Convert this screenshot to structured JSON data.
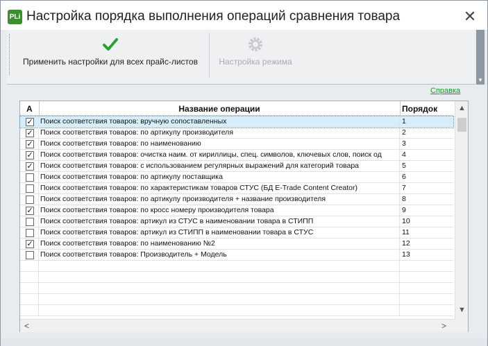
{
  "window": {
    "logo_text": "PLi",
    "title": "Настройка порядка выполнения операций сравнения товара",
    "close_glyph": "✕"
  },
  "toolbar": {
    "apply_label": "Применить настройки для всех прайс-листов",
    "apply_icon": "checkmark-icon",
    "mode_label": "Настройка режима",
    "mode_icon": "gear-icon",
    "mode_enabled": false
  },
  "help_link": "Справка",
  "grid": {
    "headers": {
      "active": "А",
      "name": "Название операции",
      "order": "Порядок"
    },
    "rows": [
      {
        "checked": true,
        "name": "Поиск соответствия товаров: вручную сопоставленных",
        "order": "1",
        "selected": true
      },
      {
        "checked": true,
        "name": "Поиск соответствия товаров: по артикулу производителя",
        "order": "2"
      },
      {
        "checked": true,
        "name": "Поиск соответствия товаров: по наименованию",
        "order": "3"
      },
      {
        "checked": true,
        "name": "Поиск соответствия товаров: очистка наим. от кириллицы, спец. символов, ключевых слов, поиск од",
        "order": "4"
      },
      {
        "checked": true,
        "name": "Поиск соответствия товаров: с использованием регулярных выражений для категорий товара",
        "order": "5"
      },
      {
        "checked": false,
        "name": "Поиск соответствия товаров: по артикулу поставщика",
        "order": "6"
      },
      {
        "checked": false,
        "name": "Поиск соответствия товаров: по характеристикам товаров СТУС (БД E-Trade Content Creator)",
        "order": "7"
      },
      {
        "checked": false,
        "name": "Поиск соответствия товаров: по артикулу производителя + название производителя",
        "order": "8"
      },
      {
        "checked": true,
        "name": "Поиск соответствия товаров: по кросс номеру производителя товара",
        "order": "9"
      },
      {
        "checked": false,
        "name": "Поиск соответствия товаров: артикул из СТУС в наименовании товара в СТИПП",
        "order": "10"
      },
      {
        "checked": false,
        "name": "Поиск соответствия товаров: артикул из СТИПП в наименовании товара в СТУС",
        "order": "11"
      },
      {
        "checked": true,
        "name": "Поиск соответствия товаров: по наименованию №2",
        "order": "12"
      },
      {
        "checked": false,
        "name": "Поиск соответствия товаров: Производитель + Модель",
        "order": "13"
      },
      {
        "checked": false,
        "name": "",
        "order": ""
      },
      {
        "checked": false,
        "name": "",
        "order": ""
      },
      {
        "checked": false,
        "name": "",
        "order": ""
      },
      {
        "checked": false,
        "name": "",
        "order": ""
      },
      {
        "checked": false,
        "name": "",
        "order": ""
      }
    ]
  },
  "colors": {
    "selected_row": "#d6eef9",
    "check_green": "#2e9e2e",
    "help_link": "#0a9a2a"
  }
}
